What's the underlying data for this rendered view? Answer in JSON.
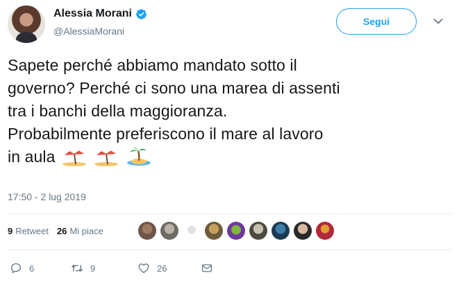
{
  "author": {
    "display_name": "Alessia Morani",
    "handle": "@AlessiaMorani",
    "verified": true
  },
  "follow_button": {
    "label": "Segui"
  },
  "tweet": {
    "text_lines": [
      "Sapete perché abbiamo mandato sotto il",
      "governo? Perché ci sono una marea di assenti",
      "tra i banchi della maggioranza.",
      "Probabilmente preferiscono il mare al lavoro",
      "in aula"
    ],
    "emojis": [
      "beach-umbrella-icon",
      "beach-umbrella-icon",
      "desert-island-icon"
    ],
    "timestamp": "17:50 - 2 lug 2019"
  },
  "stats": {
    "retweets_count": "9",
    "retweets_label": "Retweet",
    "likes_count": "26",
    "likes_label": "Mi piace",
    "liker_avatar_count": 9
  },
  "actions": {
    "reply_count": "6",
    "retweet_count": "9",
    "like_count": "26"
  },
  "colors": {
    "accent": "#1da1f2",
    "muted_text": "#657786",
    "primary_text": "#14171a",
    "divider": "#e6ecf0"
  }
}
